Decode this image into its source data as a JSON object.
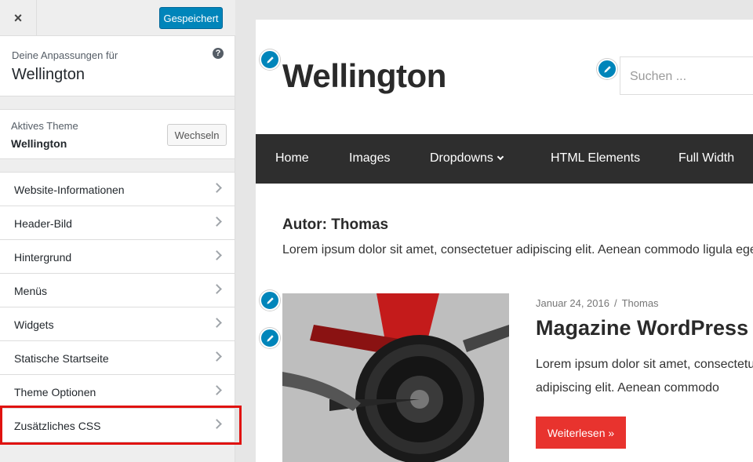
{
  "colors": {
    "accent": "#0085ba",
    "highlight": "#e0120f",
    "nav_bg": "#2e2e2e",
    "read_more": "#e8332e"
  },
  "topbar": {
    "close_icon": "×",
    "save_label": "Gespeichert"
  },
  "info": {
    "subtitle": "Deine Anpassungen für",
    "title": "Wellington",
    "help_icon": "?"
  },
  "theme": {
    "label": "Aktives Theme",
    "name": "Wellington",
    "switch_label": "Wechseln"
  },
  "menu": {
    "items": [
      {
        "label": "Website-Informationen"
      },
      {
        "label": "Header-Bild"
      },
      {
        "label": "Hintergrund"
      },
      {
        "label": "Menüs"
      },
      {
        "label": "Widgets"
      },
      {
        "label": "Statische Startseite"
      },
      {
        "label": "Theme Optionen"
      },
      {
        "label": "Zusätzliches CSS"
      }
    ]
  },
  "preview": {
    "site_title": "Wellington",
    "search_placeholder": "Suchen ...",
    "nav": [
      {
        "label": "Home"
      },
      {
        "label": "Images"
      },
      {
        "label": "Dropdowns"
      },
      {
        "label": "HTML Elements"
      },
      {
        "label": "Full Width"
      }
    ],
    "author_title": "Autor: Thomas",
    "author_desc": "Lorem ipsum dolor sit amet, consectetuer adipiscing elit. Aenean commodo ligula eget",
    "post": {
      "date": "Januar 24, 2016",
      "separator": "/",
      "author": "Thomas",
      "title": "Magazine WordPress Theme",
      "excerpt": "Lorem ipsum dolor sit amet, consectetuer adipiscing elit. Aenean commodo",
      "read_more": "Weiterlesen »"
    }
  }
}
